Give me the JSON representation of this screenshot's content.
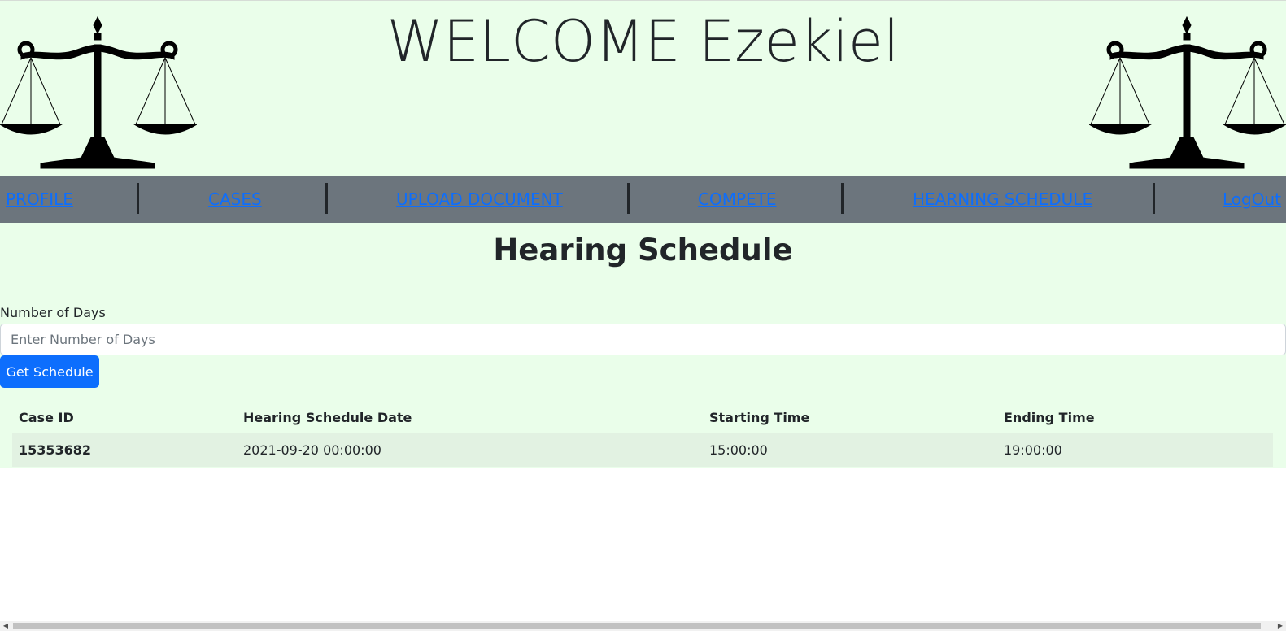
{
  "header": {
    "welcome_text": "WELCOME Ezekiel",
    "logo_icon": "scales-of-justice-icon"
  },
  "nav": {
    "items": [
      {
        "label": "PROFILE"
      },
      {
        "label": "CASES"
      },
      {
        "label": "UPLOAD DOCUMENT"
      },
      {
        "label": "COMPETE"
      },
      {
        "label": "HEARNING SCHEDULE"
      },
      {
        "label": "LogOut"
      }
    ]
  },
  "main": {
    "title": "Hearing Schedule",
    "days_label": "Number of Days",
    "days_value": "",
    "days_placeholder": "Enter Number of Days",
    "get_button": "Get Schedule"
  },
  "table": {
    "headers": [
      "Case ID",
      "Hearing Schedule Date",
      "Starting Time",
      "Ending Time"
    ],
    "rows": [
      [
        "15353682",
        "2021-09-20 00:00:00",
        "15:00:00",
        "19:00:00"
      ]
    ]
  },
  "colors": {
    "page_background": "#eafeea",
    "navbar": "#6c757d",
    "link": "#0d6efd",
    "button": "#0d6efd",
    "row_highlight": "#e2f2e2"
  }
}
